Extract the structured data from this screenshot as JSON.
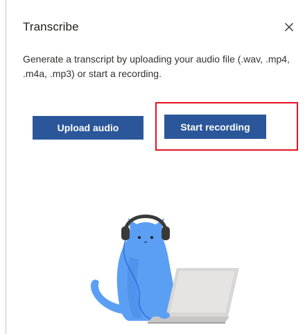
{
  "pane": {
    "title": "Transcribe",
    "close_icon": "close-icon",
    "description": "Generate a transcript by uploading your audio file (.wav, .mp4, .m4a, .mp3) or start a recording.",
    "buttons": {
      "upload_label": "Upload audio",
      "record_label": "Start recording"
    },
    "illustration": "cat-with-headphones-and-laptop",
    "colors": {
      "button_bg": "#2b579a",
      "highlight": "#e81123",
      "cat": "#5b9ff5",
      "laptop": "#d2d0ce"
    }
  }
}
